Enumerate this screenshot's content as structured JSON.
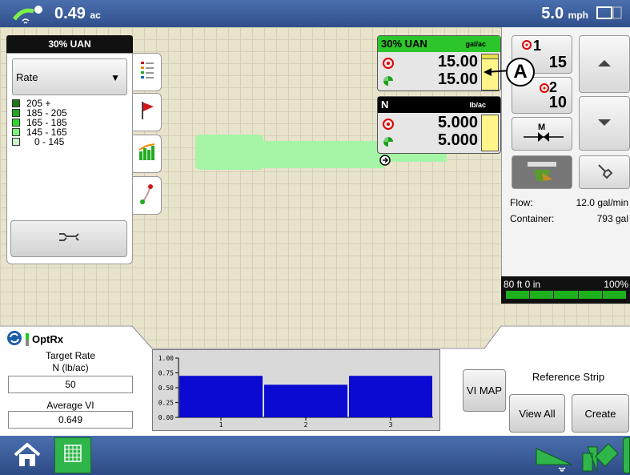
{
  "topbar": {
    "area_value": "0.49",
    "area_unit": "ac",
    "speed_value": "5.0",
    "speed_unit": "mph"
  },
  "left_panel": {
    "title": "30% UAN",
    "mode_select": "Rate",
    "legend": [
      {
        "label": "205 +",
        "color": "#1a7a1a"
      },
      {
        "label": "185 - 205",
        "color": "#22a722"
      },
      {
        "label": "165 - 185",
        "color": "#2fd62f"
      },
      {
        "label": "145 - 165",
        "color": "#7ef17e"
      },
      {
        "label": "0 - 145",
        "color": "#c9f9c9"
      }
    ]
  },
  "products": [
    {
      "name": "30% UAN",
      "unit": "gal/ac",
      "target": "15.00",
      "actual": "15.00",
      "header_color": "#2cc52c",
      "header_text": "#000000"
    },
    {
      "name": "N",
      "unit": "lb/ac",
      "target": "5.000",
      "actual": "5.000",
      "header_color": "#000000",
      "header_text": "#ffffff"
    }
  ],
  "right_panel": {
    "section1_num": "1",
    "section1_value": "15",
    "section2_num": "2",
    "section2_value": "10",
    "manual_label": "M",
    "flow_label": "Flow:",
    "flow_value": "12.0 gal/min",
    "container_label": "Container:",
    "container_value": "793 gal",
    "boom_width": "80 ft 0 in",
    "boom_percent": "100%"
  },
  "callout": "A",
  "optrx": {
    "title": "OptRx",
    "target_rate_label": "Target Rate",
    "target_rate_unit": "N (lb/ac)",
    "target_rate_value": "50",
    "average_vi_label": "Average VI",
    "average_vi_value": "0.649",
    "vi_map_button": "VI MAP",
    "reference_strip_label": "Reference Strip",
    "view_all_button": "View All",
    "create_button": "Create"
  },
  "chart_data": {
    "type": "bar",
    "categories": [
      "1",
      "2",
      "3"
    ],
    "values": [
      0.7,
      0.55,
      0.7
    ],
    "yticks": [
      "1.00",
      "0.75",
      "0.50",
      "0.25",
      "0.00"
    ],
    "ylim": [
      0,
      1
    ],
    "color": "#0a0ad2",
    "title": "",
    "xlabel": "",
    "ylabel": ""
  }
}
